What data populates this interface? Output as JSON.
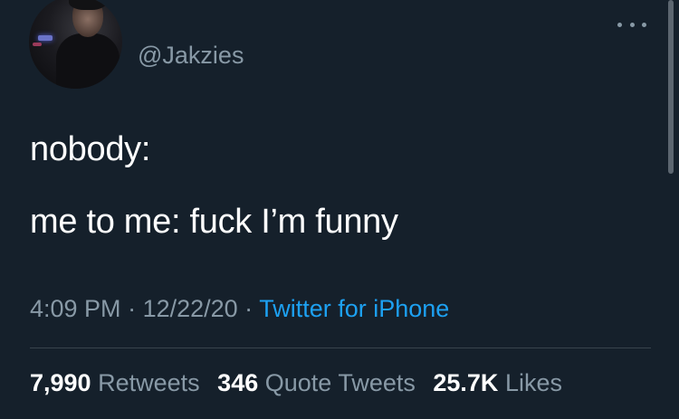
{
  "tweet": {
    "username": "@Jakzies",
    "lines": [
      "nobody:",
      "me to me: fuck I’m funny"
    ],
    "time": "4:09 PM",
    "date": "12/22/20",
    "separator": " · ",
    "source": "Twitter for iPhone"
  },
  "stats": {
    "retweets_count": "7,990",
    "retweets_label": "Retweets",
    "quotes_count": "346",
    "quotes_label": "Quote Tweets",
    "likes_count": "25.7K",
    "likes_label": "Likes"
  },
  "icons": {
    "more": "more-horizontal-icon"
  },
  "colors": {
    "background": "#15202b",
    "secondary_text": "#8899a6",
    "link": "#1da1f2",
    "divider": "#38444d"
  }
}
